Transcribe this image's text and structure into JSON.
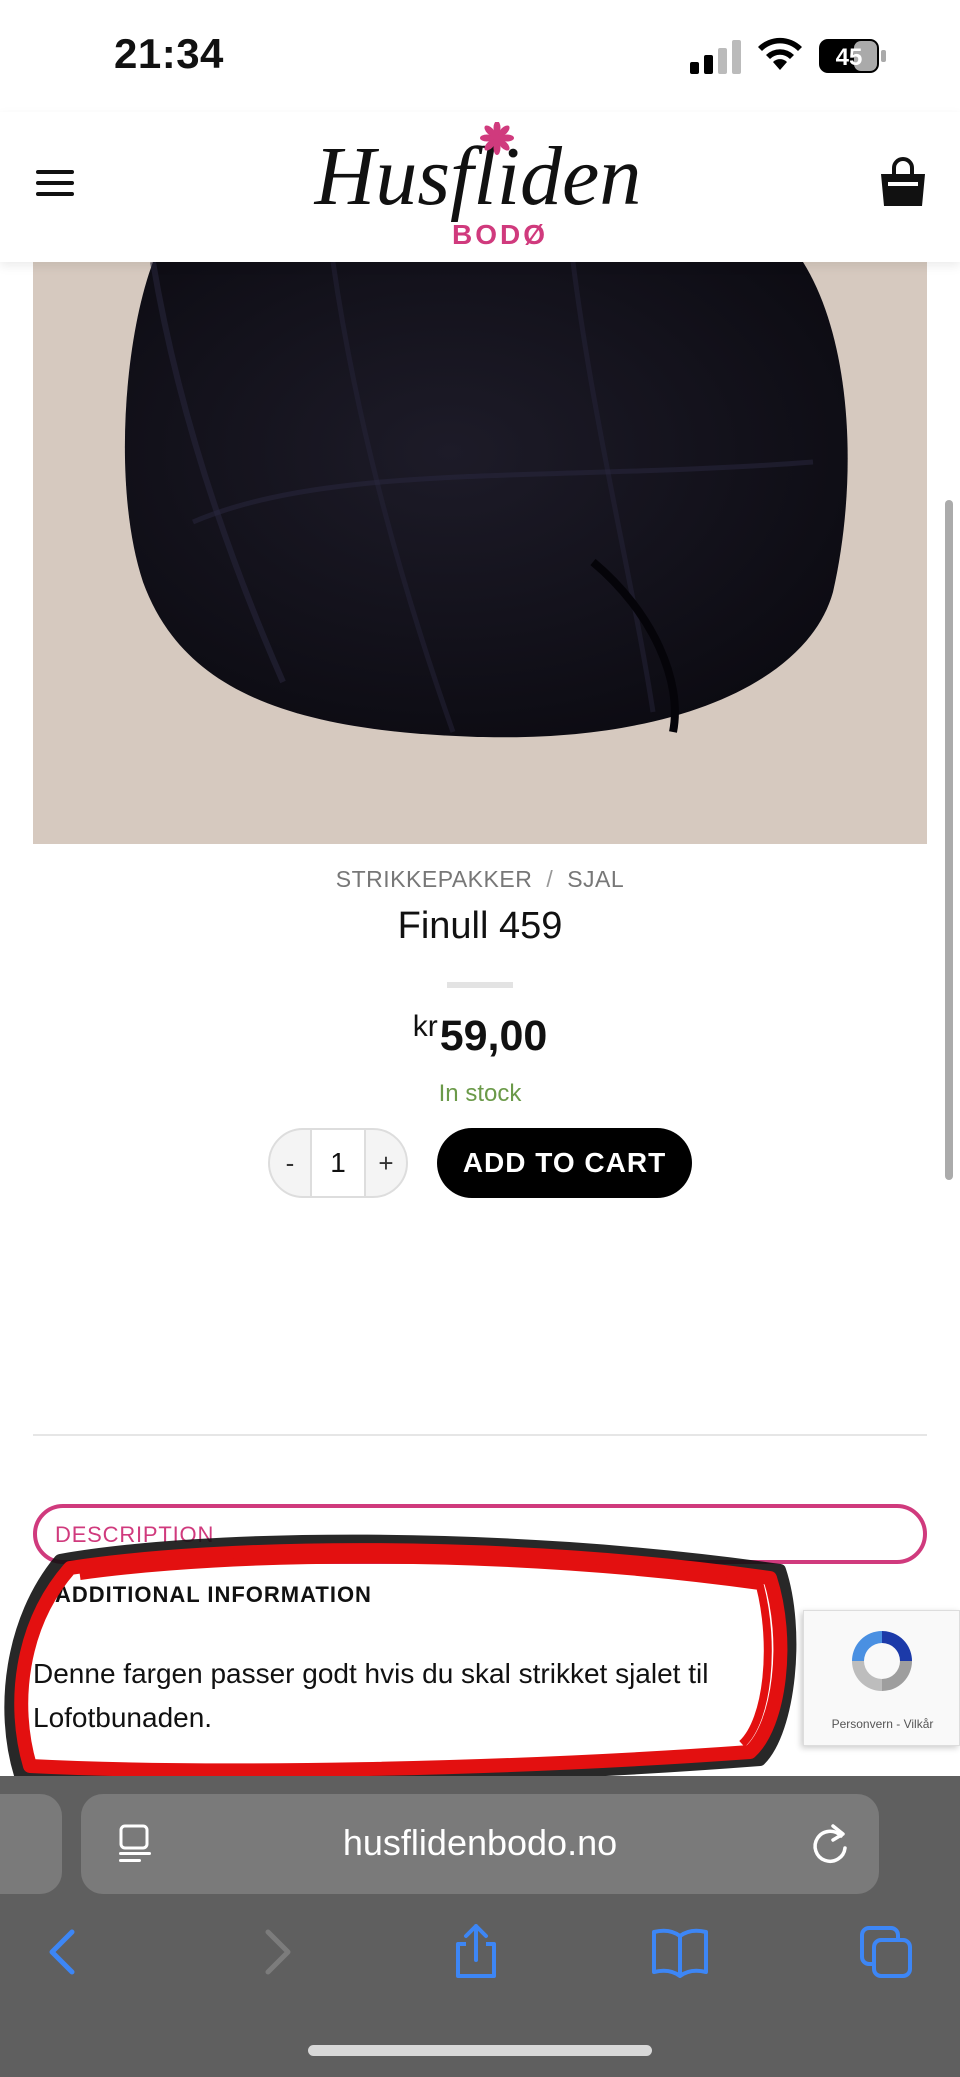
{
  "status_bar": {
    "time": "21:34",
    "battery": "45"
  },
  "header": {
    "logo_main": "Husfliden",
    "logo_sub": "BODØ"
  },
  "product": {
    "breadcrumbs": [
      "STRIKKEPAKKER",
      "SJAL"
    ],
    "breadcrumb_separator": "/",
    "title": "Finull 459",
    "currency": "kr",
    "price": "59,00",
    "stock": "In stock",
    "quantity": "1",
    "qty_minus": "-",
    "qty_plus": "+",
    "add_to_cart": "ADD TO CART",
    "yarn_color": "#14131c",
    "image_bg_color": "#d9ccc2"
  },
  "tabs": {
    "description": "DESCRIPTION",
    "additional_information": "ADDITIONAL INFORMATION"
  },
  "description_text": "Denne fargen passer godt hvis du skal strikket sjalet til Lofotbunaden.",
  "recaptcha": {
    "links": "Personvern - Vilkår"
  },
  "browser": {
    "url": "husflidenbodo.no"
  },
  "colors": {
    "accent": "#d03a7d",
    "stock": "#6b9a49",
    "annotation": "#e31010"
  }
}
